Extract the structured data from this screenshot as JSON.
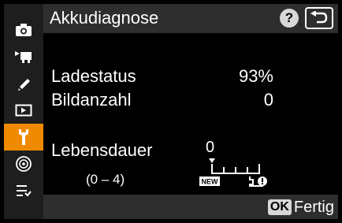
{
  "header": {
    "title": "Akkudiagnose",
    "help_label": "?",
    "back_icon": "back-arrow-icon"
  },
  "sidebar": {
    "items": [
      {
        "icon": "camera-icon",
        "active": false
      },
      {
        "icon": "movie-icon",
        "active": false
      },
      {
        "icon": "pencil-icon",
        "active": false
      },
      {
        "icon": "playback-icon",
        "active": false
      },
      {
        "icon": "wrench-icon",
        "active": true
      },
      {
        "icon": "network-icon",
        "active": false
      },
      {
        "icon": "my-menu-icon",
        "active": false
      }
    ],
    "active_color": "#f08a00"
  },
  "battery": {
    "charge_label": "Ladestatus",
    "charge_value": "93%",
    "shots_label": "Bildanzahl",
    "shots_value": "0",
    "life_label": "Lebensdauer",
    "life_range": "(0 – 4)",
    "life_value": "0",
    "life_level": 0,
    "life_max": 4,
    "scale_new_label": "NEW"
  },
  "footer": {
    "ok_badge": "OK",
    "ok_label": "Fertig"
  }
}
